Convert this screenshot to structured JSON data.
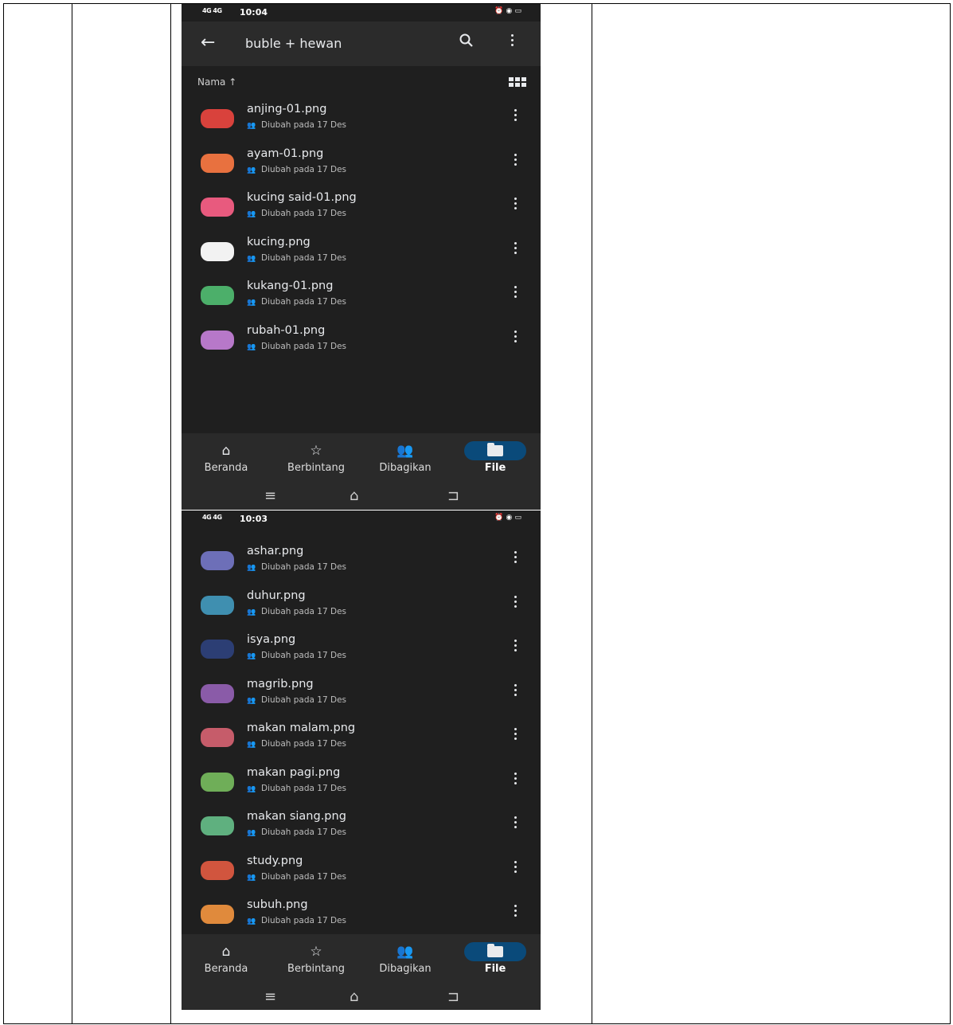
{
  "screen1": {
    "status": {
      "signal": "4G 4G",
      "time": "10:04"
    },
    "appbar": {
      "back": "←",
      "title": "buble + hewan"
    },
    "sort_label": "Nama ↑",
    "files": [
      {
        "name": "anjing-01.png",
        "meta": "Diubah pada 17 Des",
        "color": "#d9423c"
      },
      {
        "name": "ayam-01.png",
        "meta": "Diubah pada 17 Des",
        "color": "#e8713f"
      },
      {
        "name": "kucing said-01.png",
        "meta": "Diubah pada 17 Des",
        "color": "#e85a7e"
      },
      {
        "name": "kucing.png",
        "meta": "Diubah pada 17 Des",
        "color": "#f2f2f2"
      },
      {
        "name": "kukang-01.png",
        "meta": "Diubah pada 17 Des",
        "color": "#4caf6a"
      },
      {
        "name": "rubah-01.png",
        "meta": "Diubah pada 17 Des",
        "color": "#b778c9"
      }
    ],
    "nav": [
      "Beranda",
      "Berbintang",
      "Dibagikan",
      "File"
    ]
  },
  "screen2": {
    "status": {
      "signal": "4G 4G",
      "time": "10:03"
    },
    "files": [
      {
        "name": "ashar.png",
        "meta": "Diubah pada 17 Des",
        "color": "#6d6fb8"
      },
      {
        "name": "duhur.png",
        "meta": "Diubah pada 17 Des",
        "color": "#3f8fb0"
      },
      {
        "name": "isya.png",
        "meta": "Diubah pada 17 Des",
        "color": "#2c3e74"
      },
      {
        "name": "magrib.png",
        "meta": "Diubah pada 17 Des",
        "color": "#8a5ba8"
      },
      {
        "name": "makan malam.png",
        "meta": "Diubah pada 17 Des",
        "color": "#c65c6a"
      },
      {
        "name": "makan pagi.png",
        "meta": "Diubah pada 17 Des",
        "color": "#6fae58"
      },
      {
        "name": "makan siang.png",
        "meta": "Diubah pada 17 Des",
        "color": "#5fb07f"
      },
      {
        "name": "study.png",
        "meta": "Diubah pada 17 Des",
        "color": "#d1553e"
      },
      {
        "name": "subuh.png",
        "meta": "Diubah pada 17 Des",
        "color": "#e08a3c"
      }
    ],
    "nav": [
      "Beranda",
      "Berbintang",
      "Dibagikan",
      "File"
    ]
  },
  "icons": {
    "back": "arrow-left-icon",
    "search": "search-icon",
    "more": "more-vert-icon",
    "grid": "grid-view-icon",
    "home": "home-icon",
    "star": "star-icon",
    "shared": "shared-icon",
    "folder": "folder-icon"
  }
}
